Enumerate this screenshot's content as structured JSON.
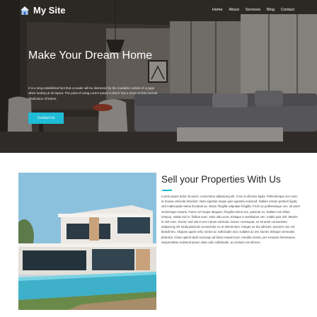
{
  "brand": {
    "name": "My Site",
    "icon": "house-icon"
  },
  "nav": {
    "items": [
      "Home",
      "About",
      "Services",
      "Blog",
      "Contact"
    ]
  },
  "hero": {
    "title": "Make Your Dream Home",
    "text": "It is a long established fact that a reader will be distracted by the readable content of a page when looking at its layout. The point of using Lorem Ipsum is that it has a more-or-less normal distribution of letters.",
    "button": "Contact Us"
  },
  "section": {
    "title": "Sell your Properties With Us",
    "text": "Lorem ipsum dolor sit amet, consectetur adipiscing elit. Cras et ultricies ligula. Pellentesque nec nunc et massa vehicula tincidunt. Nam egestas neque quis egestas euismod. Nullam ornare pretium ligula, sed malesuada metus tincidunt ac. Etiam fringilla vulputate fringilla. Proin ac pellentesque orci, sit amet scelerisque mauris. Fusce vel neque aliquam, fringilla metus nec, pulvinar ex. Nullam non tellus tempus, mattis nisl in, finibus nunc. Duis odio urna, tristique a vestibulum non, mattis quis nisl. Mauris in nisl nunc. Donec sed nisl et orci rutrum vehicula. Donec consequat, ex sit amet consectetur adipiscing elit. Nulla placerat consectetur ex ut elementum. Integer eu dui ultricies, posuere orci vel, blandit leo. Aliquam quam velit, rutrum ac sollicitudin sed, sodales ac est. Donec tristique venenatis pharetra. Class aptent taciti sociosqu ad litora torquent per conubia nostra, per inceptos himenaeos. Suspendisse euismod ipsum vitae odio sollicitudin, ac pretium est ultrices.",
    "accent": "#1fbcd6"
  },
  "colors": {
    "accent": "#1fbcd6",
    "heading": "#222222",
    "body": "#444444"
  }
}
